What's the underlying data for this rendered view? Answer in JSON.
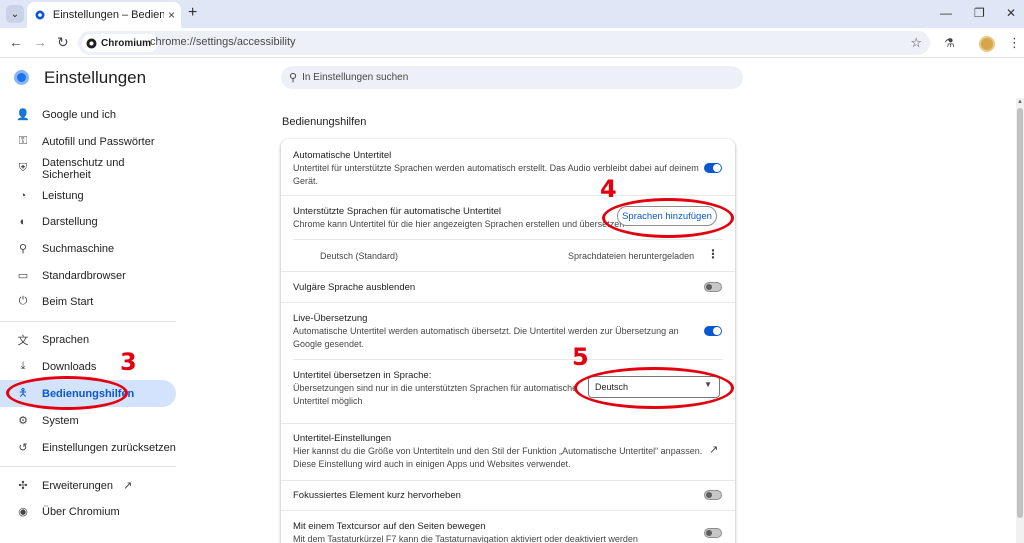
{
  "browser": {
    "tab_title": "Einstellungen – Bedienungshilfen",
    "site_chip": "Chromium",
    "url": "chrome://settings/accessibility"
  },
  "header": {
    "app_title": "Einstellungen",
    "search_placeholder": "In Einstellungen suchen"
  },
  "sidebar": {
    "items": [
      {
        "label": "Google und ich"
      },
      {
        "label": "Autofill und Passwörter"
      },
      {
        "label": "Datenschutz und Sicherheit"
      },
      {
        "label": "Leistung"
      },
      {
        "label": "Darstellung"
      },
      {
        "label": "Suchmaschine"
      },
      {
        "label": "Standardbrowser"
      },
      {
        "label": "Beim Start"
      },
      {
        "label": "Sprachen"
      },
      {
        "label": "Downloads"
      },
      {
        "label": "Bedienungshilfen"
      },
      {
        "label": "System"
      },
      {
        "label": "Einstellungen zurücksetzen"
      },
      {
        "label": "Erweiterungen"
      },
      {
        "label": "Über Chromium"
      }
    ],
    "active_index": 10
  },
  "main": {
    "section_title": "Bedienungshilfen",
    "auto_captions": {
      "title": "Automatische Untertitel",
      "desc_line1": "Untertitel für unterstützte Sprachen werden automatisch erstellt. Das Audio verbleibt dabei auf deinem",
      "desc_line2": "Gerät.",
      "enabled": true
    },
    "supported_langs": {
      "title": "Unterstützte Sprachen für automatische Untertitel",
      "desc": "Chrome kann Untertitel für die hier angezeigten Sprachen erstellen und übersetzen",
      "button": "Sprachen hinzufügen",
      "language": "Deutsch (Standard)",
      "status": "Sprachdateien heruntergeladen"
    },
    "profanity": {
      "title": "Vulgäre Sprache ausblenden",
      "enabled": false
    },
    "live_translate": {
      "title": "Live-Übersetzung",
      "desc_line1": "Automatische Untertitel werden automatisch übersetzt. Die Untertitel werden zur Übersetzung an",
      "desc_line2": "Google gesendet.",
      "enabled": true
    },
    "translate_to": {
      "title": "Untertitel übersetzen in Sprache:",
      "desc_line1": "Übersetzungen sind nur in die unterstützten Sprachen für automatische",
      "desc_line2": "Untertitel möglich",
      "selected": "Deutsch"
    },
    "caption_settings": {
      "title": "Untertitel-Einstellungen",
      "desc_line1": "Hier kannst du die Größe von Untertiteln und den Stil der Funktion „Automatische Untertitel“ anpassen.",
      "desc_line2": "Diese Einstellung wird auch in einigen Apps und Websites verwendet."
    },
    "focus_highlight": {
      "title": "Fokussiertes Element kurz hervorheben",
      "enabled": false
    },
    "caret_browsing": {
      "title": "Mit einem Textcursor auf den Seiten bewegen",
      "desc": "Mit dem Tastaturkürzel F7 kann die Tastaturnavigation aktiviert oder deaktiviert werden",
      "enabled": false
    }
  },
  "annotations": {
    "step3": "3",
    "step4": "4",
    "step5": "5",
    "color": "#e3000f"
  },
  "colors": {
    "accent": "#0b57d0",
    "active_bg": "#d3e3fd",
    "tabstrip": "#dfe6f5"
  }
}
